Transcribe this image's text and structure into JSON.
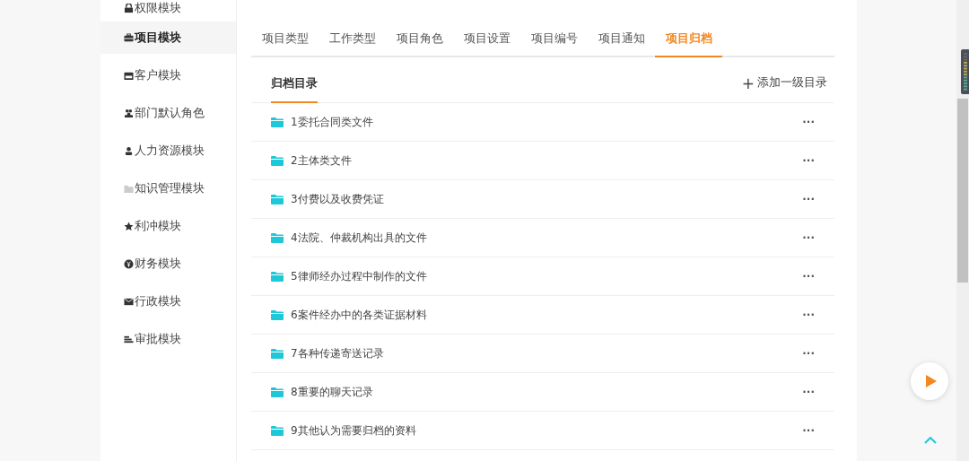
{
  "sidebar": {
    "items": [
      {
        "label": "权限模块",
        "kind": "lock",
        "selected": false
      },
      {
        "label": "项目模块",
        "kind": "briefcase",
        "selected": true
      },
      {
        "label": "客户模块",
        "kind": "card",
        "selected": false
      },
      {
        "label": "部门默认角色",
        "kind": "group",
        "selected": false
      },
      {
        "label": "人力资源模块",
        "kind": "person",
        "selected": false
      },
      {
        "label": "知识管理模块",
        "kind": "folder",
        "selected": false
      },
      {
        "label": "利冲模块",
        "kind": "star",
        "selected": false
      },
      {
        "label": "财务模块",
        "kind": "yen",
        "selected": false
      },
      {
        "label": "行政模块",
        "kind": "mail",
        "selected": false
      },
      {
        "label": "审批模块",
        "kind": "bars",
        "selected": false
      }
    ]
  },
  "tabs": [
    {
      "label": "项目类型",
      "selected": false
    },
    {
      "label": "工作类型",
      "selected": false
    },
    {
      "label": "项目角色",
      "selected": false
    },
    {
      "label": "项目设置",
      "selected": false
    },
    {
      "label": "项目编号",
      "selected": false
    },
    {
      "label": "项目通知",
      "selected": false
    },
    {
      "label": "项目归档",
      "selected": true
    }
  ],
  "archive": {
    "title": "归档目录",
    "add_button": "添加一级目录",
    "add_icon": "+",
    "menu_glyph": "···",
    "folders": [
      "1委托合同类文件",
      "2主体类文件",
      "3付费以及收费凭证",
      "4法院、仲裁机构出具的文件",
      "5律师经办过程中制作的文件",
      "6案件经办中的各类证据材料",
      "7各种传递寄送记录",
      "8重要的聊天记录",
      "9其他认为需要归档的资料"
    ]
  }
}
